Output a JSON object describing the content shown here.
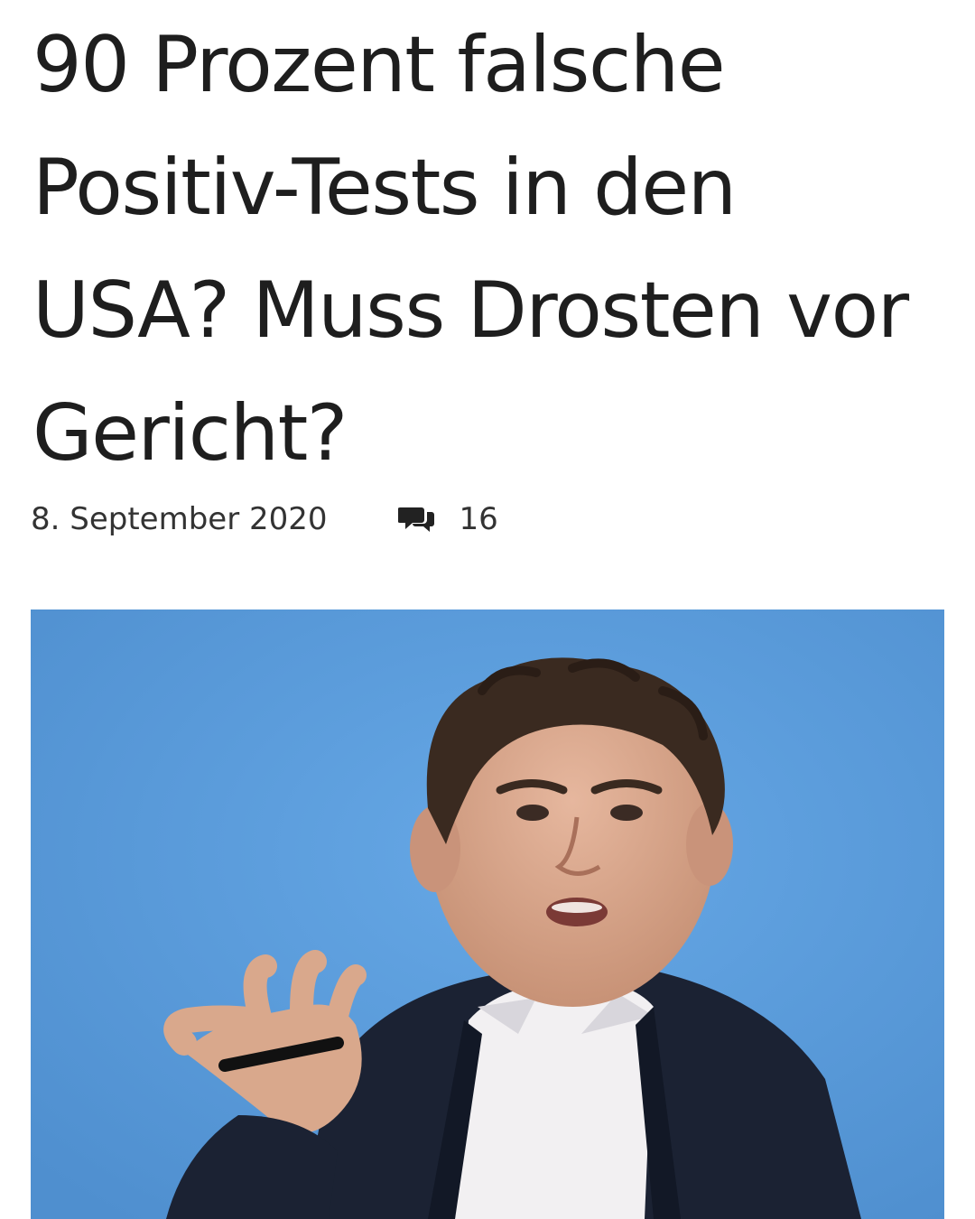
{
  "article": {
    "title": "90 Prozent falsche Positiv-Tests in den USA? Muss Drosten vor Gericht?",
    "date": "8. September 2020",
    "comment_count": "16",
    "comments_icon": "comments-icon"
  },
  "hero_image": {
    "description_icon": "portrait-photo",
    "background_color": "#5b9cdb"
  },
  "colors": {
    "text": "#1e1e1e",
    "meta_text": "#333333",
    "photo_background": "#5b9cdb",
    "jacket": "#1b2233",
    "hair": "#3a2a20",
    "skin": "#d9a88c"
  }
}
